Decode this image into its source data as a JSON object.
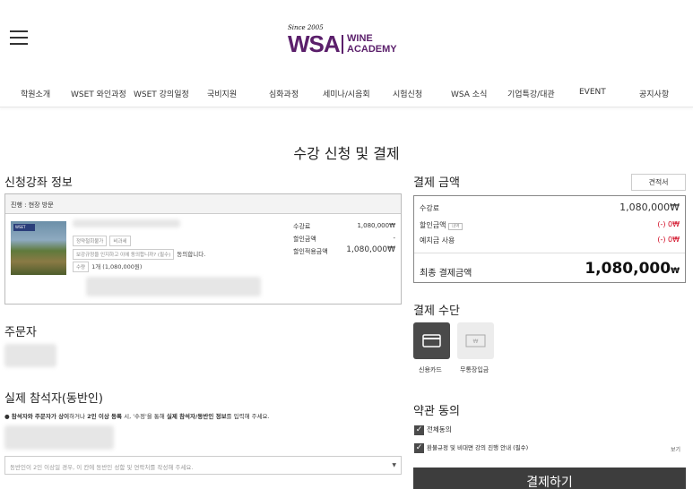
{
  "header": {
    "logo_since": "Since 2005",
    "logo_wsa": "WSA",
    "logo_wine": "WINE",
    "logo_academy": "ACADEMY",
    "brand_color": "#5b1f6b"
  },
  "nav": [
    "학원소개",
    "WSET 와인과정",
    "WSET 강의일정",
    "국비지원",
    "심화과정",
    "세미나/시음회",
    "시험신청",
    "WSA 소식",
    "기업특강/대관",
    "EVENT",
    "공지사항"
  ],
  "page_title": "수강 신청 및 결제",
  "course": {
    "section_title": "신청강좌 정보",
    "progress_label": "진행 : 현장 방문",
    "thumb_tag": "WSET",
    "chip1": "정약철회불가",
    "chip2": "비과세",
    "agree_chip": "보강규정을 인지하고 이에 동의합니까? (필수)",
    "agree_text": "동의합니다.",
    "qty_chip": "수량",
    "qty_text": "1개 (1,080,000원)",
    "fee_label": "수강료",
    "fee_value": "1,080,000₩",
    "discount_label": "할인금액",
    "discount_value": "-",
    "after_label": "할인적용금액",
    "after_value": "1,080,000₩"
  },
  "orderer": {
    "section_title": "주문자"
  },
  "attendee": {
    "section_title": "실제 참석자(동반인)",
    "notice_prefix": "● ",
    "notice_b1": "참석자와 주문자가 상이",
    "notice_t1": "하거나 ",
    "notice_b2": "2인 이상 등록",
    "notice_t2": " 시, '수정'을 통해 ",
    "notice_b3": "실제 참석자/동반인 정보",
    "notice_t3": "를 입력해 주세요.",
    "select_placeholder": "동반인이 2인 이상일 경우, 이 칸에 동반인 성함 및 연락처를 작성해 주세요."
  },
  "payment": {
    "section_title": "결제 금액",
    "quote_button": "견적서",
    "fee_label": "수강료",
    "fee_value": "1,080,000₩",
    "discount_label": "할인금액",
    "discount_chip": "내역",
    "discount_value": "(-) 0₩",
    "deposit_label": "예치금 사용",
    "deposit_value": "(-) 0₩",
    "total_label": "최종 결제금액",
    "total_value": "1,080,000",
    "total_unit": "₩",
    "accent_red": "#d0021b"
  },
  "method": {
    "section_title": "결제 수단",
    "card_label": "신용카드",
    "bank_label": "무통장입금",
    "card_icon": "credit-card-icon",
    "bank_icon": "bank-transfer-icon"
  },
  "terms": {
    "section_title": "약관 동의",
    "all_label": "전체동의",
    "refund_label": "환불규정 및 비대면 강의 진행 안내 (필수)",
    "see_label": "보기"
  },
  "pay_button": "결제하기"
}
